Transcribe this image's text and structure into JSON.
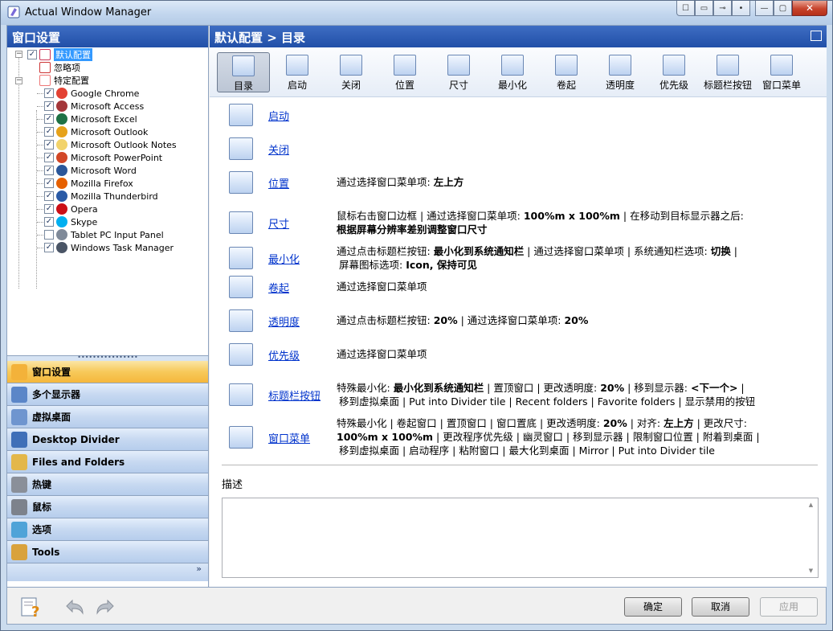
{
  "window": {
    "title": "Actual Window Manager"
  },
  "titlebar_buttons": [
    "☐",
    "▭",
    "⊸",
    "•",
    "—",
    "▢",
    "✕"
  ],
  "left_pane": {
    "title": "窗口设置",
    "tree": {
      "root": "默认配置",
      "ignore": "忽略项",
      "specific": "特定配置",
      "apps": [
        {
          "label": "Google Chrome",
          "checked": true,
          "color": "#e34133"
        },
        {
          "label": "Microsoft Access",
          "checked": true,
          "color": "#a4373a"
        },
        {
          "label": "Microsoft Excel",
          "checked": true,
          "color": "#1e7145"
        },
        {
          "label": "Microsoft Outlook",
          "checked": true,
          "color": "#e6a21a"
        },
        {
          "label": "Microsoft Outlook Notes",
          "checked": true,
          "color": "#f2d36b"
        },
        {
          "label": "Microsoft PowerPoint",
          "checked": true,
          "color": "#d24726"
        },
        {
          "label": "Microsoft Word",
          "checked": true,
          "color": "#2b579a"
        },
        {
          "label": "Mozilla Firefox",
          "checked": true,
          "color": "#e66000"
        },
        {
          "label": "Mozilla Thunderbird",
          "checked": true,
          "color": "#2a5aa6"
        },
        {
          "label": "Opera",
          "checked": true,
          "color": "#cc0f16"
        },
        {
          "label": "Skype",
          "checked": true,
          "color": "#00aff0"
        },
        {
          "label": "Tablet PC Input Panel",
          "checked": false,
          "color": "#7f8a99"
        },
        {
          "label": "Windows Task Manager",
          "checked": true,
          "color": "#4a5566"
        }
      ]
    },
    "nav": [
      {
        "label": "窗口设置",
        "active": true,
        "icon": "window-settings-icon",
        "color": "#f3b23a"
      },
      {
        "label": "多个显示器",
        "active": false,
        "icon": "multi-monitor-icon",
        "color": "#5b86c8"
      },
      {
        "label": "虚拟桌面",
        "active": false,
        "icon": "virtual-desktop-icon",
        "color": "#6f95cf"
      },
      {
        "label": "Desktop Divider",
        "active": false,
        "icon": "desktop-divider-icon",
        "color": "#3f6fb8"
      },
      {
        "label": "Files and Folders",
        "active": false,
        "icon": "folder-icon",
        "color": "#e3b74a"
      },
      {
        "label": "热键",
        "active": false,
        "icon": "keyboard-icon",
        "color": "#8a8f99"
      },
      {
        "label": "鼠标",
        "active": false,
        "icon": "mouse-icon",
        "color": "#7d828c"
      },
      {
        "label": "选项",
        "active": false,
        "icon": "options-icon",
        "color": "#4fa3d8"
      },
      {
        "label": "Tools",
        "active": false,
        "icon": "tools-icon",
        "color": "#d9a23c"
      }
    ],
    "more_chevron": "»"
  },
  "right_pane": {
    "title": "默认配置 > 目录",
    "toolbar": [
      {
        "label": "目录",
        "icon": "catalog-icon",
        "active": true
      },
      {
        "label": "启动",
        "icon": "startup-icon",
        "active": false
      },
      {
        "label": "关闭",
        "icon": "close-window-icon",
        "active": false
      },
      {
        "label": "位置",
        "icon": "position-icon",
        "active": false
      },
      {
        "label": "尺寸",
        "icon": "size-icon",
        "active": false
      },
      {
        "label": "最小化",
        "icon": "minimize-icon",
        "active": false
      },
      {
        "label": "卷起",
        "icon": "rollup-icon",
        "active": false
      },
      {
        "label": "透明度",
        "icon": "transparency-icon",
        "active": false
      },
      {
        "label": "优先级",
        "icon": "priority-icon",
        "active": false
      },
      {
        "label": "标题栏按钮",
        "icon": "titlebar-buttons-icon",
        "active": false
      },
      {
        "label": "窗口菜单",
        "icon": "window-menu-icon",
        "active": false
      }
    ],
    "rows": [
      {
        "link": "启动",
        "icon": "startup-icon",
        "lines": []
      },
      {
        "link": "关闭",
        "icon": "close-window-icon",
        "lines": []
      },
      {
        "link": "位置",
        "icon": "position-icon",
        "lines": [
          "通过选择窗口菜单项: <b>左上方</b>"
        ]
      },
      {
        "link": "尺寸",
        "icon": "size-icon",
        "lines": [
          "鼠标右击窗口边框 | 通过选择窗口菜单项: <b>100%m x 100%m</b> | 在移动到目标显示器之后:",
          "<b>根据屏幕分辨率差别调整窗口尺寸</b>"
        ]
      },
      {
        "link": "最小化",
        "icon": "minimize-icon",
        "lines": [
          "通过点击标题栏按钮: <b>最小化到系统通知栏</b> | 通过选择窗口菜单项 | 系统通知栏选项: <b>切换</b> |",
          "屏幕图标选项: <b>Icon, 保持可见</b>"
        ]
      },
      {
        "link": "卷起",
        "icon": "rollup-icon",
        "lines": [
          "通过选择窗口菜单项"
        ]
      },
      {
        "link": "透明度",
        "icon": "transparency-icon",
        "lines": [
          "通过点击标题栏按钮: <b>20%</b> | 通过选择窗口菜单项: <b>20%</b>"
        ]
      },
      {
        "link": "优先级",
        "icon": "priority-icon",
        "lines": [
          "通过选择窗口菜单项"
        ]
      },
      {
        "link": "标题栏按钮",
        "icon": "titlebar-buttons-icon",
        "lines": [
          "特殊最小化: <b>最小化到系统通知栏</b> | 置顶窗口 | 更改透明度: <b>20%</b> | 移到显示器: <b>&lt;下一个&gt;</b> |",
          "移到虚拟桌面 | Put into Divider tile | Recent folders | Favorite folders | 显示禁用的按钮"
        ]
      },
      {
        "link": "窗口菜单",
        "icon": "window-menu-icon",
        "lines": [
          "特殊最小化 | 卷起窗口 | 置顶窗口 | 窗口置底 | 更改透明度: <b>20%</b> | 对齐: <b>左上方</b> | 更改尺寸:",
          "<b>100%m x 100%m</b> | 更改程序优先级 | 幽灵窗口 | 移到显示器 | 限制窗口位置 | 附着到桌面 |",
          "移到虚拟桌面 | 启动程序 | 粘附窗口 | 最大化到桌面 | Mirror | Put into Divider tile"
        ]
      }
    ],
    "description_label": "描述",
    "description_value": ""
  },
  "buttons": {
    "ok": "确定",
    "cancel": "取消",
    "apply": "应用"
  }
}
